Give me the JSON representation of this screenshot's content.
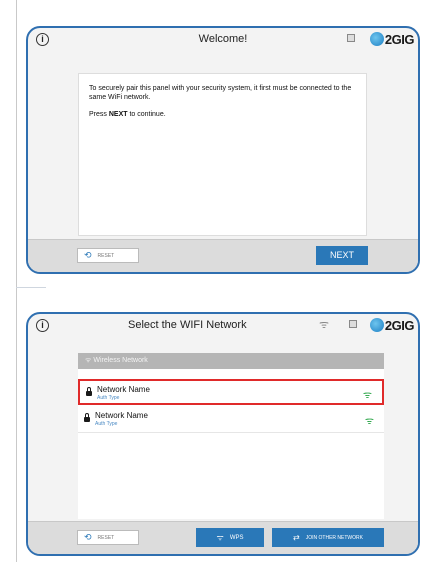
{
  "welcome_panel": {
    "title": "Welcome!",
    "logo_text": "2GIG",
    "message_line1": "To securely pair this panel with your security system, it first must be connected to the same WiFi network.",
    "message_line2_prefix": "Press ",
    "message_line2_bold": "NEXT",
    "message_line2_suffix": " to continue.",
    "reset_label": "RESET",
    "next_label": "NEXT"
  },
  "wifi_panel": {
    "title": "Select the WIFI Network",
    "logo_text": "2GIG",
    "list_header": "Wireless Network",
    "networks": [
      {
        "name": "Network Name",
        "auth": "Auth Type",
        "selected": true
      },
      {
        "name": "Network Name",
        "auth": "Auth Type",
        "selected": false
      }
    ],
    "reset_label": "RESET",
    "wps_label": "WPS",
    "join_label": "JOIN OTHER NETWORK"
  },
  "icons": {
    "info": "info-icon",
    "grid": "grid-icon",
    "wifi": "wifi-icon",
    "lock": "lock-icon",
    "reset": "refresh-icon"
  },
  "colors": {
    "accent": "#2a78b8",
    "panel_border": "#2f6fb0",
    "selected_border": "#e02a2a",
    "signal": "#2da64a"
  }
}
